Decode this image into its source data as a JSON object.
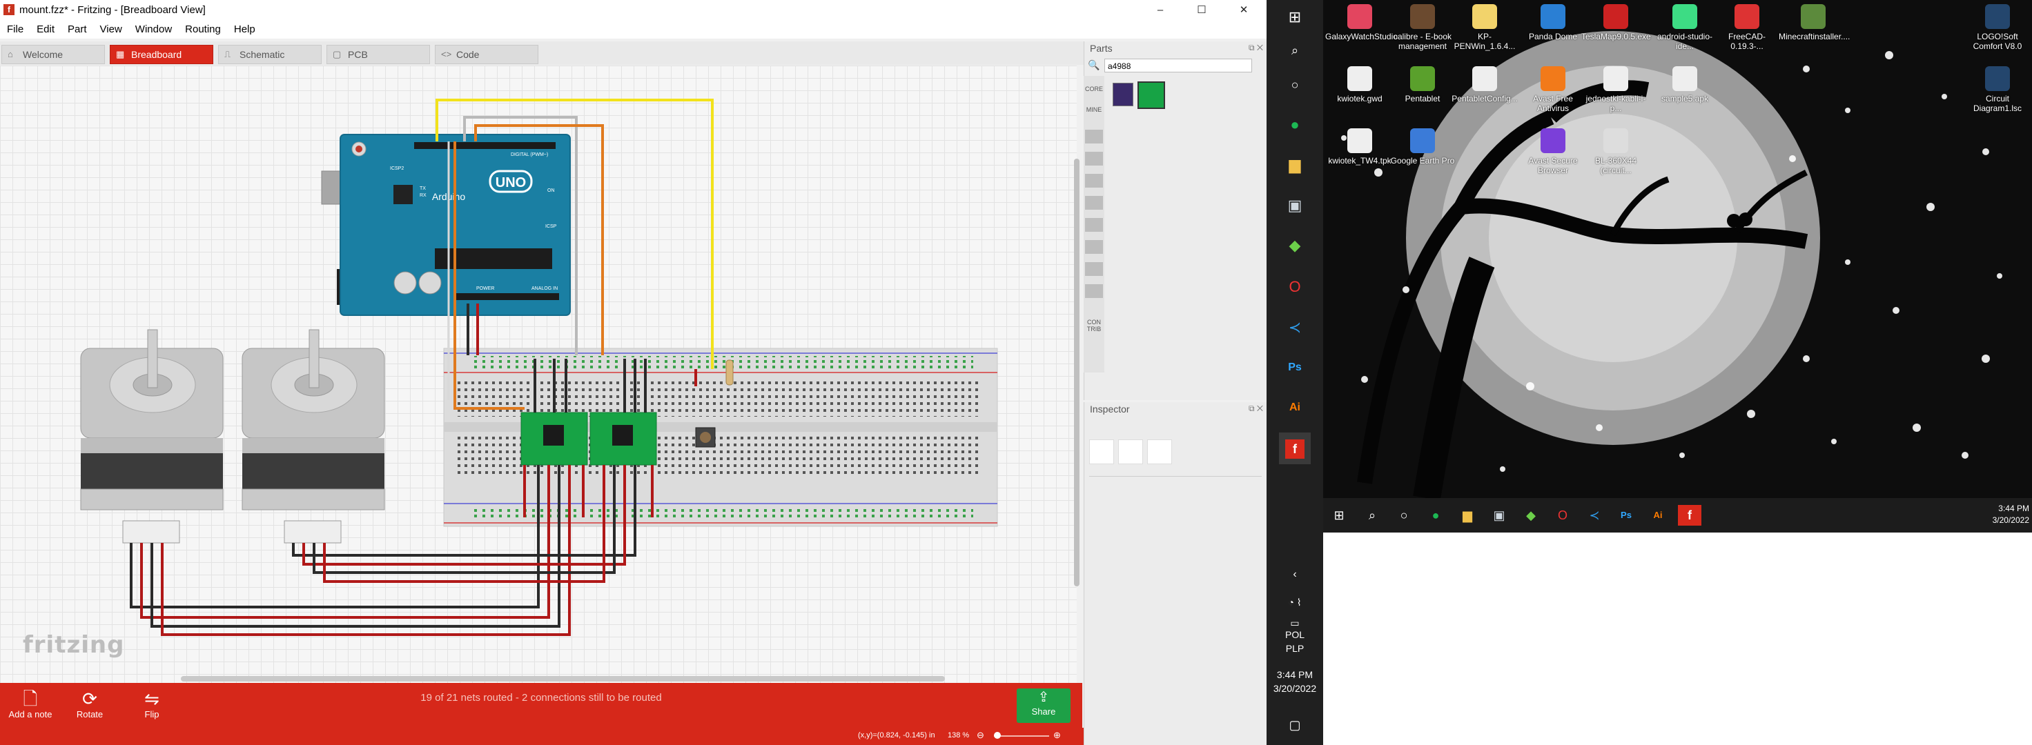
{
  "window": {
    "title": "mount.fzz* - Fritzing - [Breadboard View]",
    "app_icon": "f"
  },
  "window_controls": {
    "minimize": "–",
    "maximize": "☐",
    "close": "✕"
  },
  "menu": [
    "File",
    "Edit",
    "Part",
    "View",
    "Window",
    "Routing",
    "Help"
  ],
  "tabs": [
    {
      "label": "Welcome",
      "icon": "⌂"
    },
    {
      "label": "Breadboard",
      "icon": "▦"
    },
    {
      "label": "Schematic",
      "icon": "⎍"
    },
    {
      "label": "PCB",
      "icon": "▢"
    },
    {
      "label": "Code",
      "icon": "<>"
    }
  ],
  "canvas": {
    "logo": "fritzing",
    "board": {
      "name": "UNO",
      "brand": "Arduino",
      "labels": [
        "DIGITAL (PWM~)",
        "ANALOG IN",
        "POWER",
        "ICSP2",
        "ICSP",
        "ON",
        "TX",
        "RX"
      ]
    }
  },
  "toolbar": {
    "add_note": "Add a note",
    "rotate": "Rotate",
    "flip": "Flip",
    "share": "Share"
  },
  "routing_status": "19 of 21 nets routed - 2 connections still to be routed",
  "statusbar": {
    "coords": "(x,y)=(0.824, -0.145) in",
    "zoom": "138 %"
  },
  "parts": {
    "title": "Parts",
    "search_value": "a4988",
    "bins": [
      "CORE",
      "MINE",
      "CON TRIB"
    ]
  },
  "inspector": {
    "title": "Inspector"
  },
  "vtaskbar": {
    "lang": "POL",
    "currency": "PLP",
    "time": "3:44 PM",
    "date": "3/20/2022"
  },
  "desktop": {
    "icons": [
      {
        "label": "GalaxyWatchStudio",
        "color": "#e3455f"
      },
      {
        "label": "calibre - E-book management",
        "color": "#6b4a2f"
      },
      {
        "label": "KP-PENWin_1.6.4...",
        "color": "#f2d36b"
      },
      {
        "label": "Panda Dome",
        "color": "#2a7fd4"
      },
      {
        "label": "TeslaMap9.0.5.exe",
        "color": "#c22"
      },
      {
        "label": "android-studio-ide...",
        "color": "#3ddc84"
      },
      {
        "label": "FreeCAD-0.19.3-...",
        "color": "#d33"
      },
      {
        "label": "Minecraftinstaller....",
        "color": "#5c8a3c"
      },
      {
        "label": "LOGO!Soft Comfort V8.0",
        "color": "#24466d"
      },
      {
        "label": "kwiotek.gwd",
        "color": "#eeeeee"
      },
      {
        "label": "Pentablet",
        "color": "#5aa02c"
      },
      {
        "label": "PentabletConfig...",
        "color": "#eeeeee"
      },
      {
        "label": "Avast Free Antivirus",
        "color": "#f27a1a"
      },
      {
        "label": "jednostki-kabli-i-p...",
        "color": "#eeeeee"
      },
      {
        "label": "sample5.apk",
        "color": "#eeeeee"
      },
      {
        "label": "Circuit Diagram1.lsc",
        "color": "#24466d"
      },
      {
        "label": "kwiotek_TW4.tpk",
        "color": "#eeeeee"
      },
      {
        "label": "Google Earth Pro",
        "color": "#3b7bd8"
      },
      {
        "label": "Avast Secure Browser",
        "color": "#7b3fd9"
      },
      {
        "label": "BL-360X44 (circuit...",
        "color": "#dddddd"
      }
    ],
    "clock_time": "3:44 PM",
    "clock_date": "3/20/2022"
  }
}
